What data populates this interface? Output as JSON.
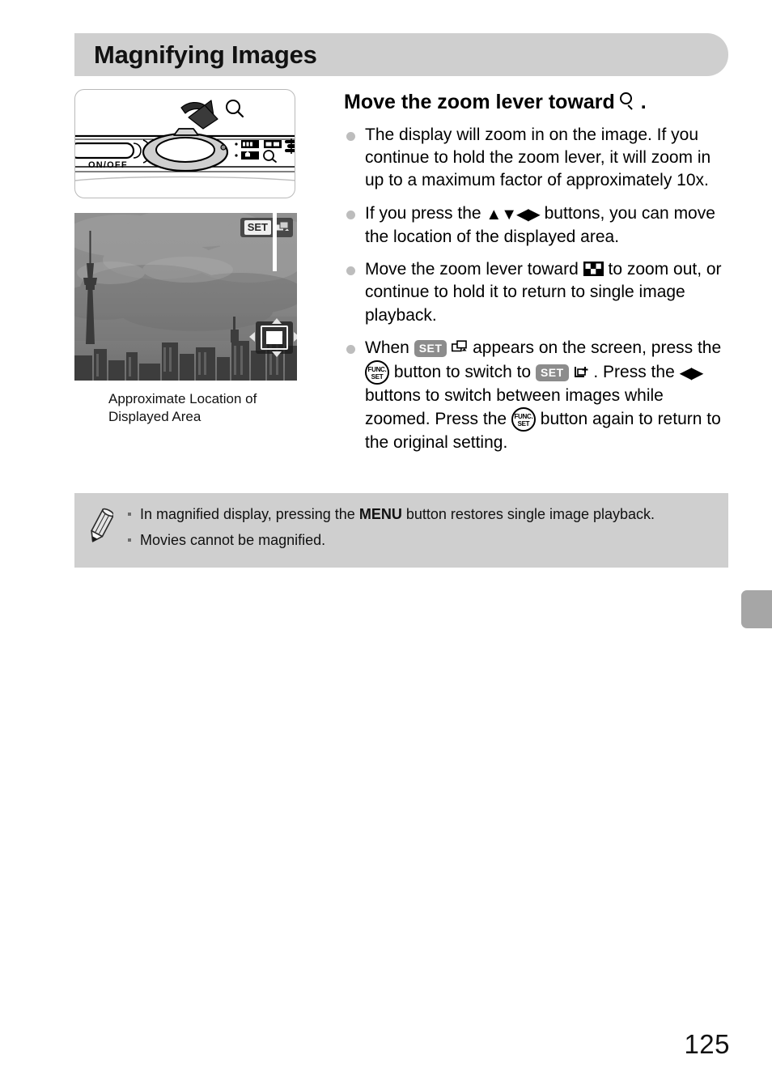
{
  "page": {
    "title": "Magnifying Images",
    "number": "125"
  },
  "figures": {
    "camera": {
      "name": "camera-top-zoom-lever-illustration",
      "onoff_label": "ON/OFF",
      "magnify_icon": "magnify-icon",
      "index_icon": "index-icon",
      "arrow_icon": "curved-arrow-icon"
    },
    "photo": {
      "name": "magnified-playback-screen-photo",
      "subject": "city skyline with tower under cloudy sky",
      "set_badge_label": "SET",
      "set_badge_icon": "image-switch-icon",
      "location_indicator_icon": "displayed-area-indicator-icon"
    },
    "caption": "Approximate Location of Displayed Area"
  },
  "instructions": {
    "heading_before": "Move the zoom lever toward",
    "heading_icon": "magnify-icon",
    "heading_after": ".",
    "bullets": [
      {
        "id": "bullet-zoom-in",
        "parts": [
          {
            "type": "text",
            "value": "The display will zoom in on the image. If you continue to hold the zoom lever, it will zoom in up to a maximum factor of approximately 10x."
          }
        ]
      },
      {
        "id": "bullet-move-area",
        "parts": [
          {
            "type": "text",
            "value": "If you press the "
          },
          {
            "type": "icon",
            "value": "updown-leftright-arrows-icon",
            "glyph": "▲▼◀▶"
          },
          {
            "type": "text",
            "value": " buttons, you can move the location of the displayed area."
          }
        ]
      },
      {
        "id": "bullet-zoom-out",
        "parts": [
          {
            "type": "text",
            "value": "Move the zoom lever toward "
          },
          {
            "type": "icon",
            "value": "index-icon"
          },
          {
            "type": "text",
            "value": " to zoom out, or continue to hold it to return to single image playback."
          }
        ]
      },
      {
        "id": "bullet-switch-images",
        "parts": [
          {
            "type": "text",
            "value": "When "
          },
          {
            "type": "icon",
            "value": "set-badge-icon",
            "glyph": "SET"
          },
          {
            "type": "icon",
            "value": "image-switch-icon"
          },
          {
            "type": "text",
            "value": " appears on the screen, press the "
          },
          {
            "type": "icon",
            "value": "func-set-button-icon",
            "glyph": "FUNC. SET"
          },
          {
            "type": "text",
            "value": " button to switch to "
          },
          {
            "type": "icon",
            "value": "set-badge-icon",
            "glyph": "SET"
          },
          {
            "type": "icon",
            "value": "jump-icon"
          },
          {
            "type": "text",
            "value": ". Press the "
          },
          {
            "type": "icon",
            "value": "leftright-arrows-icon",
            "glyph": "◀▶"
          },
          {
            "type": "text",
            "value": " buttons to switch between images while zoomed. Press the "
          },
          {
            "type": "icon",
            "value": "func-set-button-icon",
            "glyph": "FUNC. SET"
          },
          {
            "type": "text",
            "value": " button again to return to the original setting."
          }
        ]
      }
    ],
    "bullet_text": {
      "b1": "The display will zoom in on the image. If you continue to hold the zoom lever, it will zoom in up to a maximum factor of approximately 10x.",
      "b2_a": "If you press the",
      "b2_b": "buttons, you can move the location of the displayed area.",
      "b3_a": "Move the zoom lever toward",
      "b3_b": "to zoom out, or continue to hold it to return to single image playback.",
      "b4_a": "When",
      "b4_b": "appears on the screen, press the",
      "b4_c": "button to switch to",
      "b4_d": ". Press the",
      "b4_e": "buttons to switch between images while zoomed. Press the",
      "b4_f": "button again to return to the original setting."
    }
  },
  "note": {
    "icon": "pencil-icon",
    "items": [
      {
        "id": "note-menu-button",
        "a": "In magnified display, pressing the",
        "menu_label": "MENU",
        "b": "button restores single image playback."
      },
      {
        "id": "note-movies",
        "a": "Movies cannot be magnified."
      }
    ]
  },
  "icons": {
    "func_set_line1": "FUNC.",
    "func_set_line2": "SET",
    "set_label": "SET",
    "menu_label": "MENU"
  },
  "colors": {
    "title_bar": "#cfcfcf",
    "note_bar": "#cfcfcf",
    "bullet": "#bdbdbd",
    "edge_tab": "#a6a6a6",
    "text": "#111111"
  }
}
